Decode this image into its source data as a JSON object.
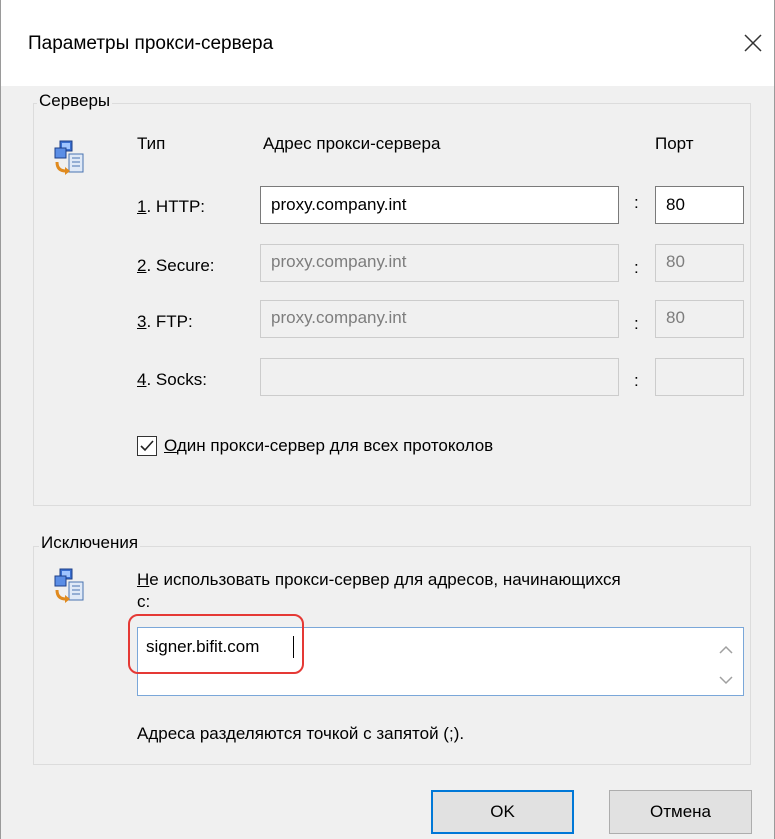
{
  "window": {
    "title": "Параметры прокси-сервера"
  },
  "servers": {
    "group_label": "Серверы",
    "col_type": "Тип",
    "col_address": "Адрес прокси-сервера",
    "col_port": "Порт",
    "rows": [
      {
        "num": "1",
        "label": ". HTTP:",
        "address": "proxy.company.int",
        "port": "80",
        "enabled": true
      },
      {
        "num": "2",
        "label": ". Secure:",
        "address": "proxy.company.int",
        "port": "80",
        "enabled": false
      },
      {
        "num": "3",
        "label": ". FTP:",
        "address": "proxy.company.int",
        "port": "80",
        "enabled": false
      },
      {
        "num": "4",
        "label": ". Socks:",
        "address": "",
        "port": "",
        "enabled": false
      }
    ],
    "colon": ":",
    "same_proxy": {
      "checked": true,
      "first_char": "О",
      "rest": "дин прокси-сервер для всех протоколов"
    }
  },
  "exceptions": {
    "group_label": "Исключения",
    "description_first_char": "Н",
    "description_rest": "е использовать прокси-сервер для адресов, начинающихся",
    "description_line2": "с:",
    "value": "signer.bifit.com",
    "hint": "Адреса разделяются точкой с запятой (;)."
  },
  "buttons": {
    "ok": "OK",
    "cancel": "Отмена"
  },
  "colors": {
    "accent": "#0078d7",
    "highlight": "#e53935"
  }
}
